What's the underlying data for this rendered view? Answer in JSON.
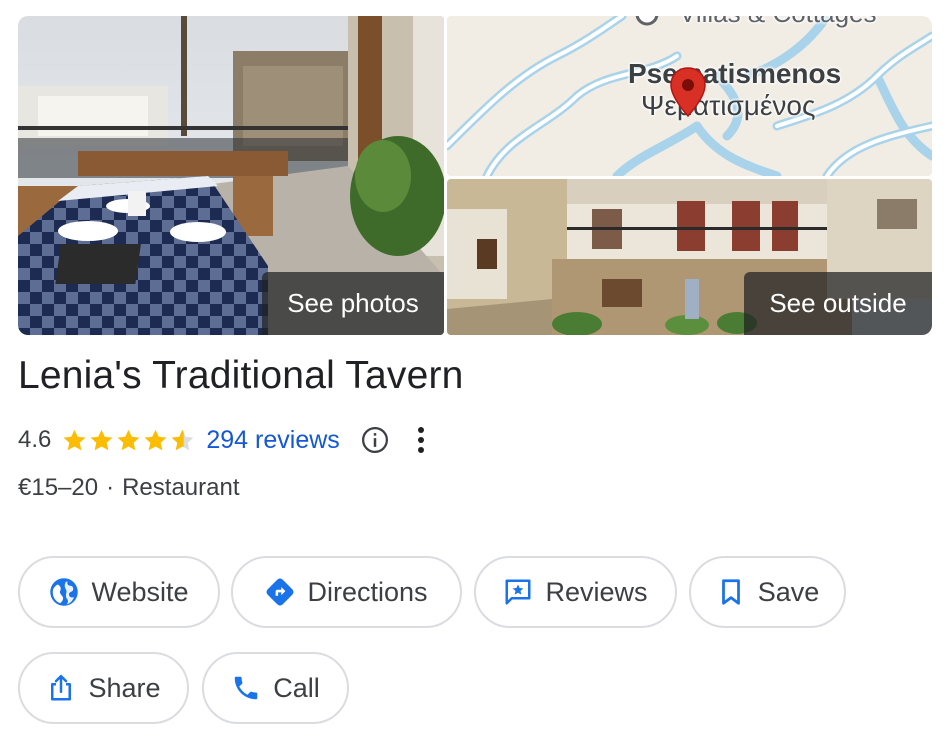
{
  "media": {
    "photos_label": "See photos",
    "outside_label": "See outside",
    "map": {
      "place_name_en": "Psematismenos",
      "place_name_gr": "Ψεματισμένος",
      "top_label_partial": "Villas & Cottages",
      "pin_color": "#d93025"
    }
  },
  "place": {
    "title": "Lenia's Traditional Tavern",
    "rating": "4.6",
    "stars": 4.6,
    "reviews_label": "294 reviews",
    "price": "€15–20",
    "separator": "·",
    "category": "Restaurant"
  },
  "actions": {
    "website": "Website",
    "directions": "Directions",
    "reviews": "Reviews",
    "save": "Save",
    "share": "Share",
    "call": "Call"
  },
  "colors": {
    "accent_blue": "#1a73e8",
    "link_blue": "#1558d6",
    "star_gold": "#fbbc04",
    "chip_border": "#dadce0",
    "text_primary": "#202124",
    "text_secondary": "#3c4043"
  },
  "icons": [
    "globe-icon",
    "directions-icon",
    "reviews-icon",
    "bookmark-icon",
    "share-icon",
    "phone-icon",
    "info-icon",
    "more-vert-icon",
    "star-icon",
    "map-pin-icon"
  ]
}
